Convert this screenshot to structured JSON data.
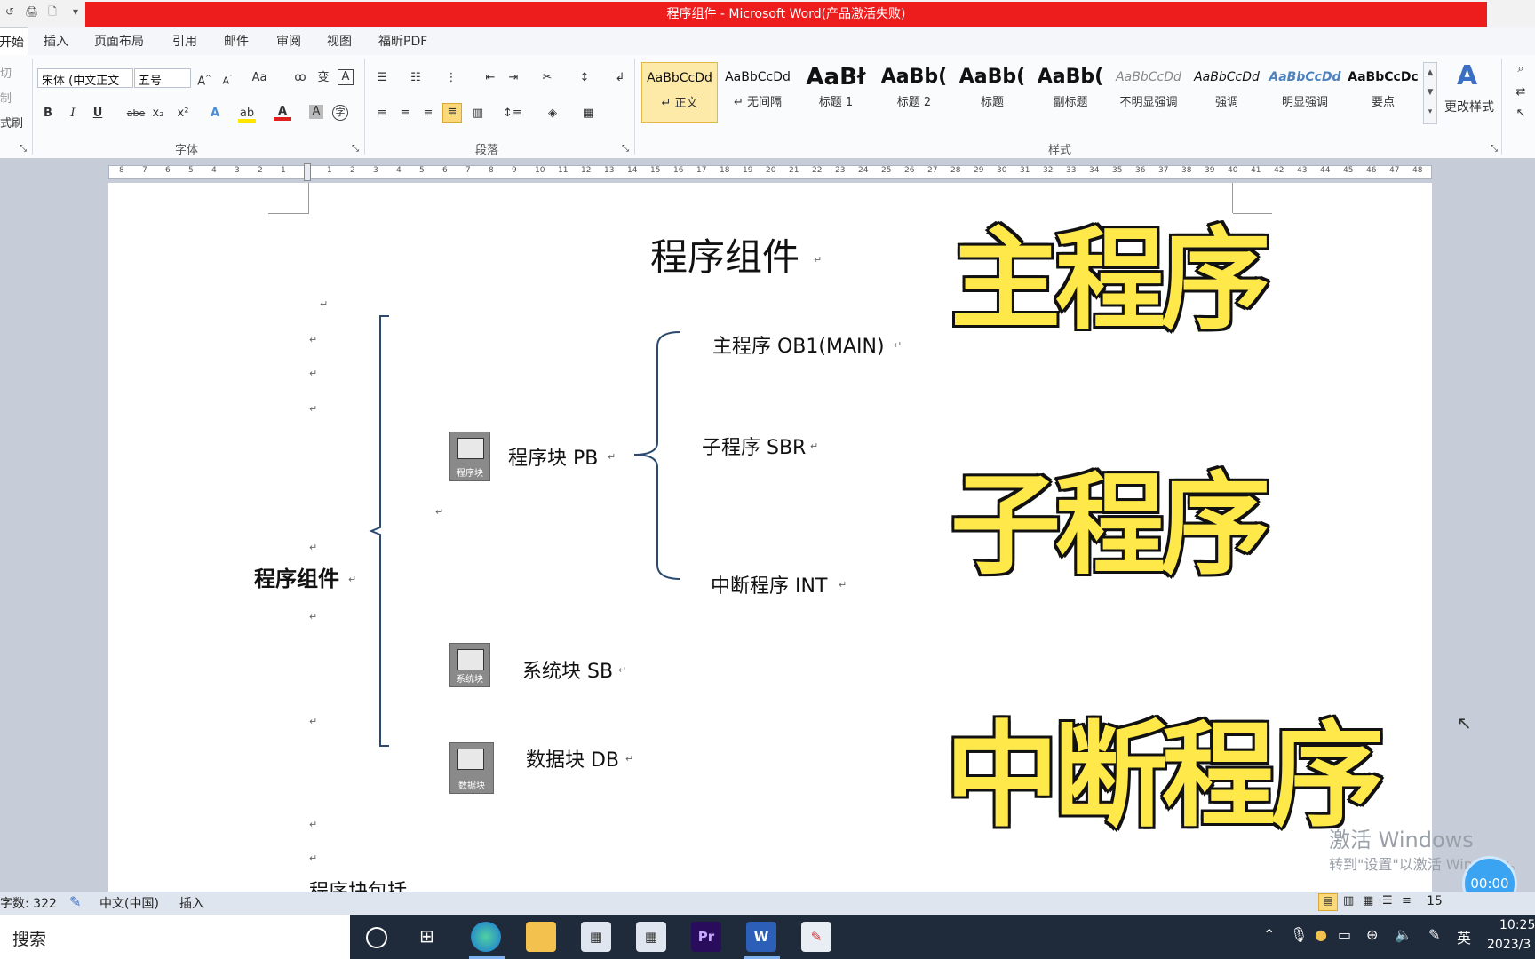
{
  "window": {
    "title": "程序组件 - Microsoft Word(产品激活失败)"
  },
  "quick_access": [
    "↺",
    "🖨",
    "🗋",
    "▾"
  ],
  "tabs": [
    {
      "label": "开始",
      "active": true
    },
    {
      "label": "插入"
    },
    {
      "label": "页面布局"
    },
    {
      "label": "引用"
    },
    {
      "label": "邮件"
    },
    {
      "label": "审阅"
    },
    {
      "label": "视图"
    },
    {
      "label": "福昕PDF"
    }
  ],
  "clipboard": {
    "items": [
      "切",
      "制",
      "式刷"
    ]
  },
  "font": {
    "name": "宋体 (中文正文",
    "size": "五号",
    "group_label": "字体",
    "buttons": [
      "B",
      "I",
      "U",
      "abe",
      "x₂",
      "x²"
    ]
  },
  "paragraph": {
    "group_label": "段落"
  },
  "styles": {
    "group_label": "样式",
    "change_label": "更改样式",
    "items": [
      {
        "preview": "AaBbCcDd",
        "name": "↵ 正文",
        "selected": true
      },
      {
        "preview": "AaBbCcDd",
        "name": "↵ 无间隔"
      },
      {
        "preview": "AaBł",
        "name": "标题 1"
      },
      {
        "preview": "AaBb(",
        "name": "标题 2"
      },
      {
        "preview": "AaBb(",
        "name": "标题"
      },
      {
        "preview": "AaBb(",
        "name": "副标题"
      },
      {
        "preview": "AaBbCcDd",
        "name": "不明显强调"
      },
      {
        "preview": "AaBbCcDd",
        "name": "强调"
      },
      {
        "preview": "AaBbCcDd",
        "name": "明显强调"
      },
      {
        "preview": "AaBbCcDc",
        "name": "要点"
      }
    ]
  },
  "ruler": {
    "left_ticks": [
      "8",
      "7",
      "6",
      "5",
      "4",
      "3",
      "2",
      "1"
    ],
    "right_ticks": [
      "1",
      "2",
      "3",
      "4",
      "5",
      "6",
      "7",
      "8",
      "9",
      "10",
      "11",
      "12",
      "13",
      "14",
      "15",
      "16",
      "17",
      "18",
      "19",
      "20",
      "21",
      "22",
      "23",
      "24",
      "25",
      "26",
      "27",
      "28",
      "29",
      "30",
      "31",
      "32",
      "33",
      "34",
      "35",
      "36",
      "37",
      "38",
      "39",
      "40",
      "41",
      "42",
      "43",
      "44",
      "45",
      "46",
      "47",
      "48"
    ]
  },
  "document": {
    "title": "程序组件",
    "root_label": "程序组件",
    "blocks": [
      {
        "label": "程序块 PB",
        "icon_caption": "程序块"
      },
      {
        "label": "系统块 SB",
        "icon_caption": "系统块"
      },
      {
        "label": "数据块 DB",
        "icon_caption": "数据块"
      }
    ],
    "pb_children": [
      "主程序 OB1(MAIN)",
      "子程序 SBR",
      "中断程序 INT"
    ],
    "cut_off_text": "程序块包括",
    "para_mark": "↵"
  },
  "overlay_text": [
    "主程序",
    "子程序",
    "中断程序"
  ],
  "watermark": {
    "line1": "激活 Windows",
    "line2": "转到\"设置\"以激活 Windows。"
  },
  "timer": "00:00",
  "status": {
    "word_count": "字数: 322",
    "language": "中文(中国)",
    "mode": "插入",
    "zoom": "15"
  },
  "taskbar": {
    "search": "搜索",
    "apps": [
      "edge",
      "explorer",
      "app1",
      "app2",
      "Pr",
      "W",
      "paint"
    ],
    "tray": {
      "lang": "英",
      "time": "10:25",
      "date": "2023/3"
    }
  },
  "colors": {
    "title_red": "#ee1d1d",
    "bracket": "#2c4a6e",
    "stamp_fill": "#ffe94a"
  }
}
